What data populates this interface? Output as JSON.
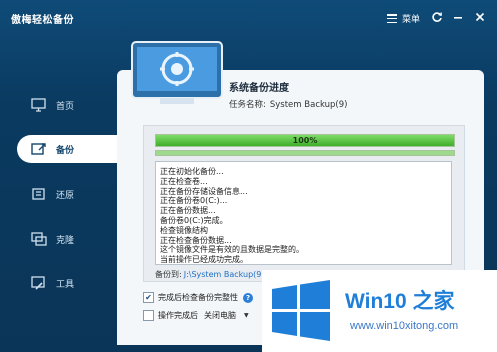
{
  "window": {
    "title": "傲梅轻松备份"
  },
  "titlebar": {
    "menu_label": "菜单"
  },
  "sidebar": {
    "items": [
      {
        "label": "首页",
        "icon": "monitor-home-icon",
        "active": false
      },
      {
        "label": "备份",
        "icon": "backup-icon",
        "active": true
      },
      {
        "label": "还原",
        "icon": "restore-icon",
        "active": false
      },
      {
        "label": "克隆",
        "icon": "clone-icon",
        "active": false
      },
      {
        "label": "工具",
        "icon": "tools-icon",
        "active": false
      }
    ]
  },
  "task": {
    "heading": "系统备份进度",
    "name_label": "任务名称:",
    "name_value": "System Backup(9)"
  },
  "progress": {
    "percent_text": "100%",
    "value": 1.0
  },
  "log": {
    "lines": [
      "正在初始化备份...",
      "正在检查卷...",
      "正在备份存储设备信息...",
      "正在备份卷0(C:)...",
      "正在备份数据...",
      "备份卷0(C:)完成。",
      "检查镜像结构",
      "正在检查备份数据...",
      "这个镜像文件是有效的且数据是完整的。",
      "当前操作已经成功完成。"
    ]
  },
  "destination": {
    "label": "备份到:",
    "path": "J:\\System Backup(9)"
  },
  "options": {
    "verify_label": "完成后检查备份完整性",
    "verify_checked": true,
    "after_label": "操作完成后",
    "after_checked": false,
    "after_value": "关闭电脑"
  },
  "watermark": {
    "brand": "Win10",
    "brand_zh": "之家",
    "url": "www.win10xitong.com"
  },
  "colors": {
    "accent": "#1f7fd8",
    "progress": "#3fae2c",
    "window_bg": "#0f4b78"
  }
}
